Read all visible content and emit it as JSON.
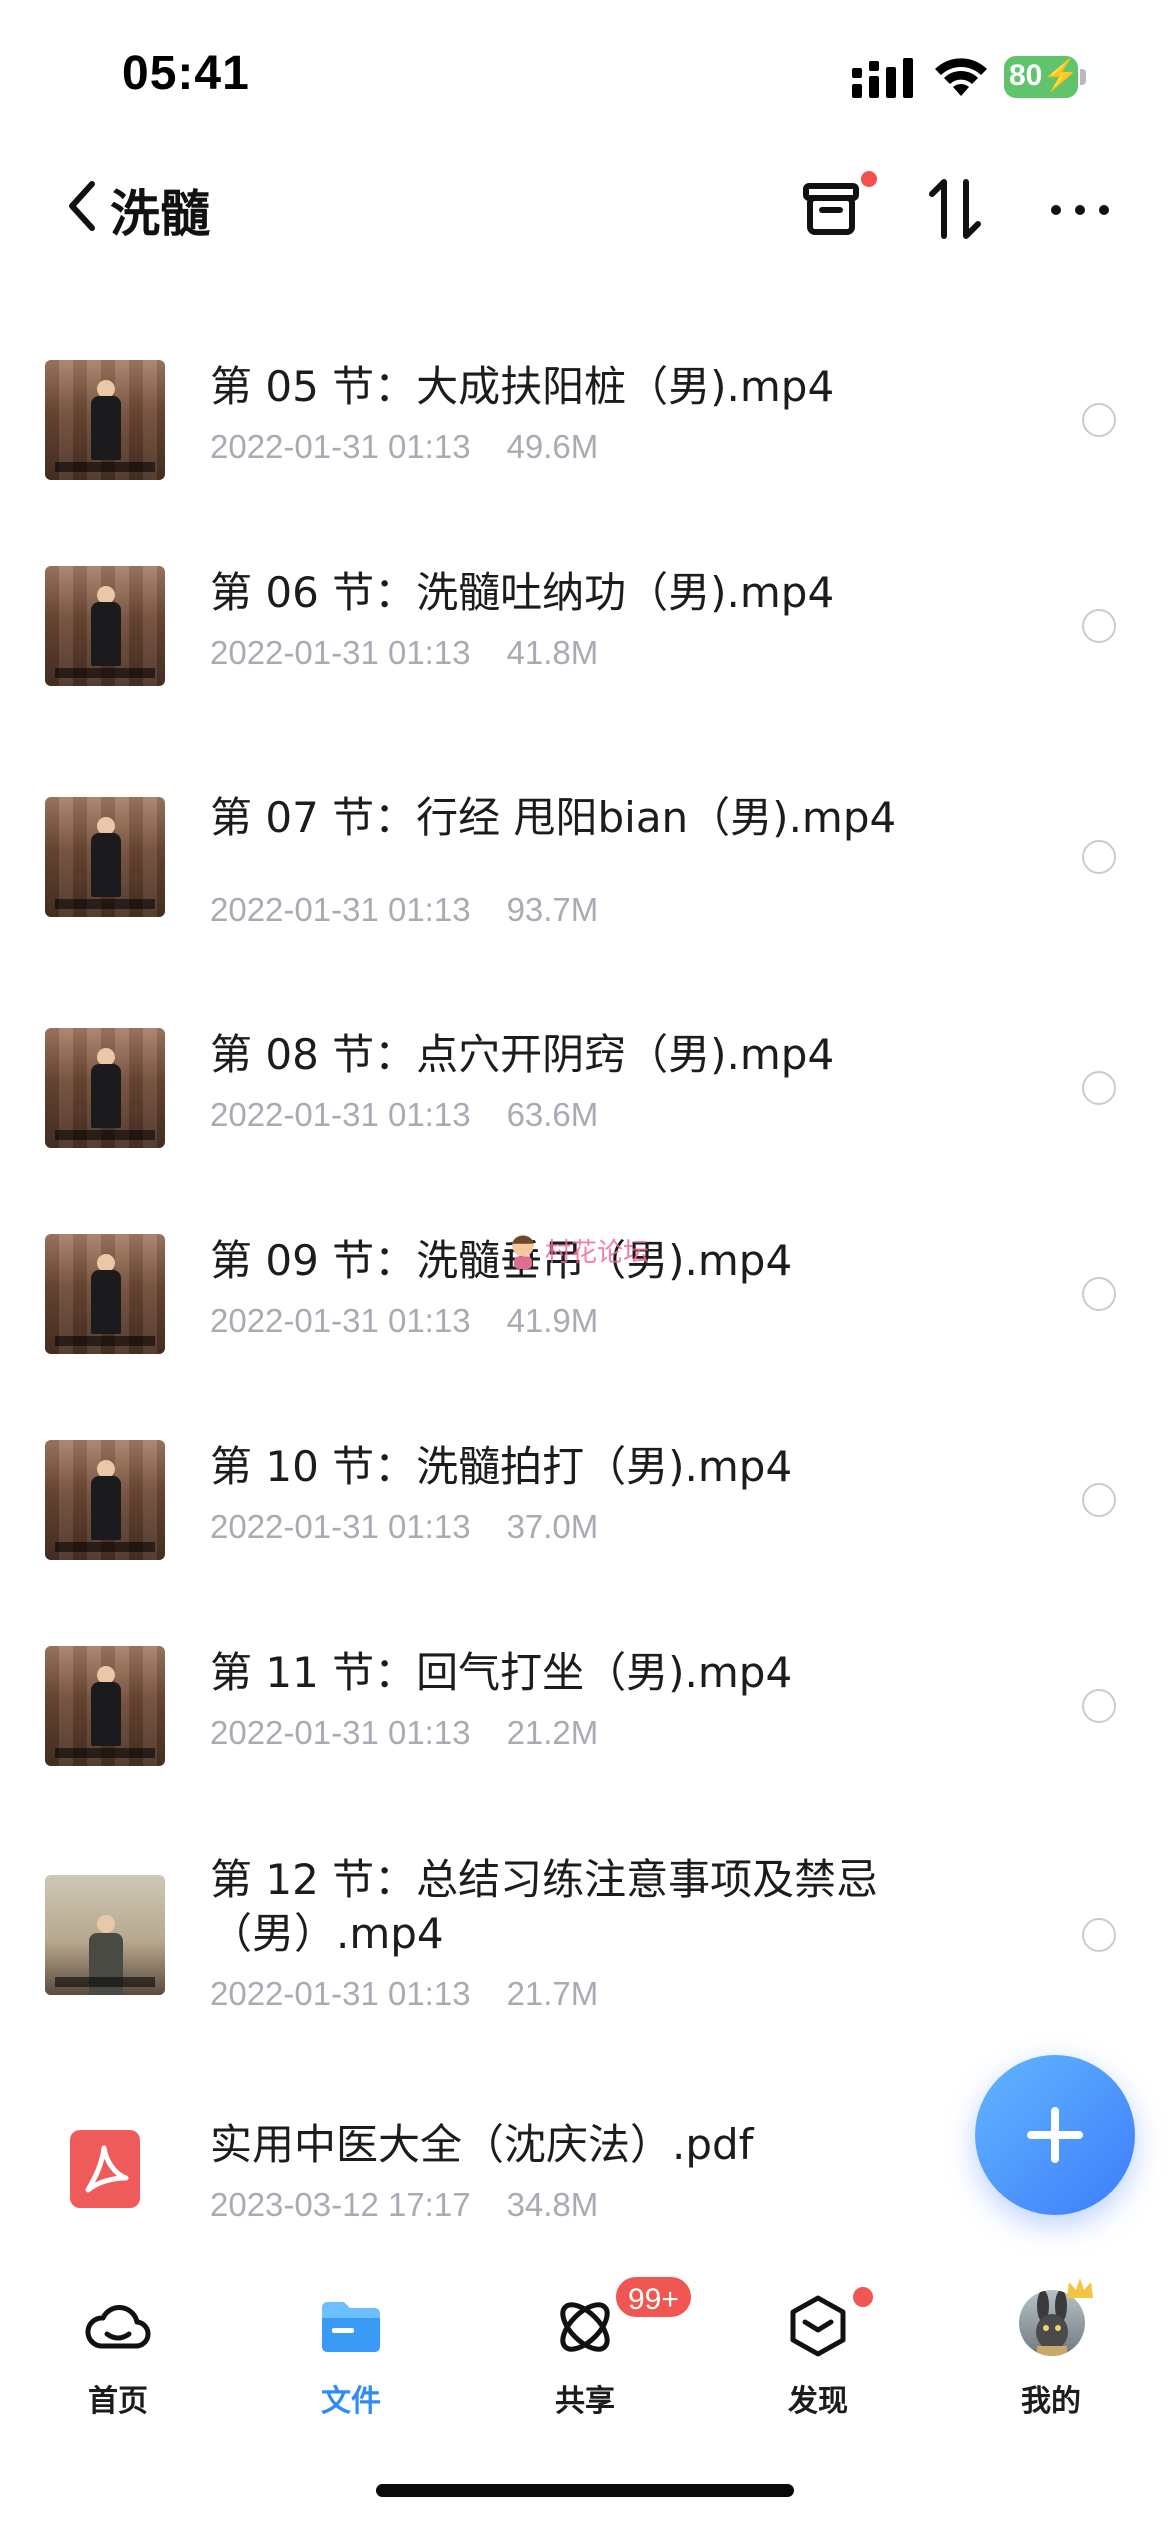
{
  "status_bar": {
    "time": "05:41",
    "battery": "80"
  },
  "nav": {
    "title": "洗髓"
  },
  "files": [
    {
      "name": "第 05 节：大成扶阳桩（男).mp4",
      "date": "2022-01-31 01:13",
      "size": "49.6M",
      "type": "video"
    },
    {
      "name": "第 06 节：洗髓吐纳功（男).mp4",
      "date": "2022-01-31 01:13",
      "size": "41.8M",
      "type": "video"
    },
    {
      "name": "第 07 节：行经 甩阳bian（男).mp4",
      "date": "2022-01-31 01:13",
      "size": "93.7M",
      "type": "video"
    },
    {
      "name": "第 08 节：点穴开阴窍（男).mp4",
      "date": "2022-01-31 01:13",
      "size": "63.6M",
      "type": "video"
    },
    {
      "name": "第 09 节：洗髓垂吊（男).mp4",
      "date": "2022-01-31 01:13",
      "size": "41.9M",
      "type": "video"
    },
    {
      "name": "第 10 节：洗髓拍打（男).mp4",
      "date": "2022-01-31 01:13",
      "size": "37.0M",
      "type": "video"
    },
    {
      "name": "第 11 节：回气打坐（男).mp4",
      "date": "2022-01-31 01:13",
      "size": "21.2M",
      "type": "video"
    },
    {
      "name": "第 12 节：总结习练注意事项及禁忌（男）.mp4",
      "date": "2022-01-31 01:13",
      "size": "21.7M",
      "type": "video"
    },
    {
      "name": "实用中医大全（沈庆法）.pdf",
      "date": "2023-03-12 17:17",
      "size": "34.8M",
      "type": "pdf"
    }
  ],
  "watermark": "村花论坛",
  "tabs": [
    {
      "label": "首页",
      "icon": "cloud-icon"
    },
    {
      "label": "文件",
      "icon": "folder-icon",
      "active": true
    },
    {
      "label": "共享",
      "icon": "share-orbit-icon",
      "badge": "99+"
    },
    {
      "label": "发现",
      "icon": "discover-box-icon"
    },
    {
      "label": "我的",
      "icon": "avatar"
    }
  ],
  "colors": {
    "accent": "#2f8cf5",
    "badge": "#f05652",
    "meta": "#a8abb3",
    "pdf": "#ef5b5b"
  }
}
